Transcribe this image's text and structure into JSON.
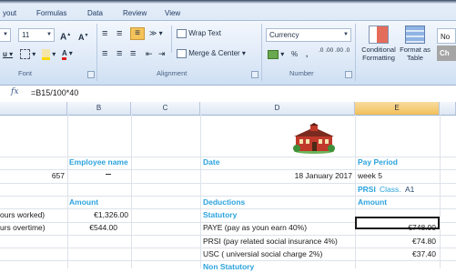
{
  "ribbon": {
    "tabs": [
      "yout",
      "Formulas",
      "Data",
      "Review",
      "View"
    ],
    "font": {
      "size": "11",
      "grow_label": "A",
      "shrink_label": "A",
      "group_label": "Font"
    },
    "alignment": {
      "wrap_text": "Wrap Text",
      "merge_center": "Merge & Center",
      "group_label": "Alignment"
    },
    "number": {
      "format": "Currency",
      "percent": "%",
      "comma": ",",
      "increase_decimal": ".0 .00",
      "decrease_decimal": ".00 .0",
      "group_label": "Number"
    },
    "styles": {
      "conditional_formatting": "Conditional Formatting",
      "format_as_table": "Format as Table",
      "normal": "No",
      "check": "Ch"
    }
  },
  "formula_bar": {
    "fx": "fx",
    "formula": "=B15/100*40"
  },
  "columns": [
    {
      "label": "",
      "selected": false
    },
    {
      "label": "B",
      "selected": false
    },
    {
      "label": "C",
      "selected": false
    },
    {
      "label": "D",
      "selected": false
    },
    {
      "label": "E",
      "selected": true
    }
  ],
  "sheet": {
    "employee_name_header": "Employee name",
    "employee_id": "657",
    "date_header": "Date",
    "date_value": "18 January 2017",
    "pay_period_header": "Pay Period",
    "pay_period_value": "week 5",
    "prsi_label": "PRSI",
    "prsi_class_label": "Class.",
    "prsi_class_value": "A1",
    "amount_header_b": "Amount",
    "deductions_header": "Deductions",
    "amount_header_e": "Amount",
    "statutory_header": "Statutory",
    "row_hours_worked": "ours worked)",
    "row_hours_worked_amount": "€1,326.00",
    "row_overtime": "urs overtime)",
    "row_overtime_amount": "€544.00",
    "paye_label": "PAYE (pay as youn earn 40%)",
    "paye_amount": "€748.00",
    "prsi_row_label": "PRSI (pay related social insurance 4%)",
    "prsi_amount": "€74.80",
    "usc_label": "USC ( universial social charge 2%)",
    "usc_amount": "€37.40",
    "non_statutory_header": "Non Statutory"
  }
}
